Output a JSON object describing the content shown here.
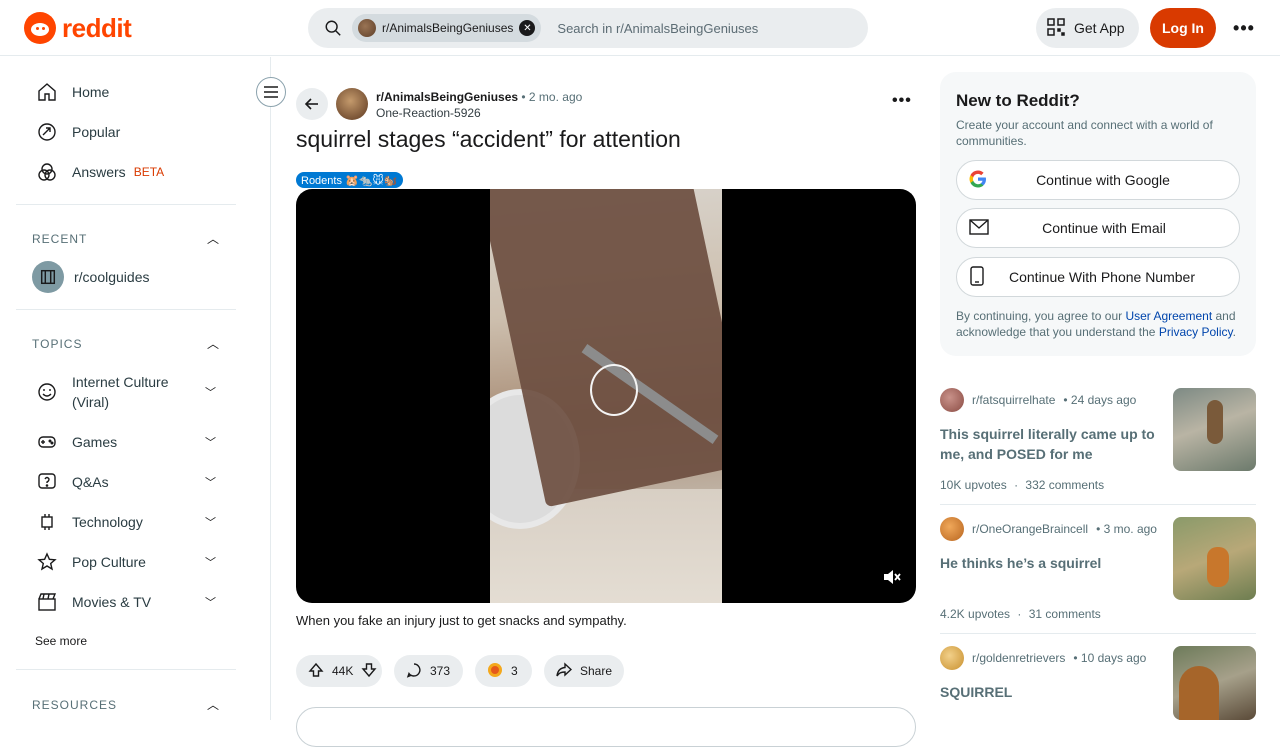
{
  "header": {
    "logo_text": "reddit",
    "search": {
      "chip_label": "r/AnimalsBeingGeniuses",
      "placeholder": "Search in r/AnimalsBeingGeniuses"
    },
    "get_app_label": "Get App",
    "login_label": "Log In",
    "more_label": "•••",
    "accent_color": "#d93a00"
  },
  "sidebar": {
    "nav": [
      {
        "label": "Home",
        "icon": "home-icon"
      },
      {
        "label": "Popular",
        "icon": "popular-icon"
      },
      {
        "label": "Answers",
        "icon": "answers-icon",
        "badge": "BETA"
      }
    ],
    "recent": {
      "title": "RECENT",
      "items": [
        {
          "label": "r/coolguides",
          "icon": "coolguides-icon"
        }
      ]
    },
    "topics": {
      "title": "TOPICS",
      "items": [
        {
          "label": "Internet Culture (Viral)",
          "icon": "smile-icon"
        },
        {
          "label": "Games",
          "icon": "gamepad-icon"
        },
        {
          "label": "Q&As",
          "icon": "question-icon"
        },
        {
          "label": "Technology",
          "icon": "chip-icon"
        },
        {
          "label": "Pop Culture",
          "icon": "star-icon"
        },
        {
          "label": "Movies & TV",
          "icon": "clapper-icon"
        }
      ],
      "see_more": "See more"
    },
    "resources": {
      "title": "RESOURCES"
    }
  },
  "post": {
    "subreddit": "r/AnimalsBeingGeniuses",
    "time": "• 2 mo. ago",
    "author": "One-Reaction-5926",
    "title": "squirrel stages “accident” for attention",
    "flair": "Rodents 🐹🐀🐭🐿️",
    "caption": "When you fake an injury just to get snacks and sympathy.",
    "upvotes": "44K",
    "comments": "373",
    "awards": "3",
    "share_label": "Share",
    "more_label": "•••"
  },
  "signup": {
    "title": "New to Reddit?",
    "subtitle": "Create your account and connect with a world of communities.",
    "google": "Continue with Google",
    "email": "Continue with Email",
    "phone": "Continue With Phone Number",
    "legal_prefix": "By continuing, you agree to our ",
    "legal_link1": "User Agreement",
    "legal_mid": " and acknowledge that you understand the ",
    "legal_link2": "Privacy Policy",
    "legal_suffix": "."
  },
  "related": [
    {
      "subreddit": "r/fatsquirrelhate",
      "time": "• 24 days ago",
      "title": "This squirrel literally came up to me, and POSED for me",
      "upvotes": "10K upvotes",
      "sep": "·",
      "comments": "332 comments"
    },
    {
      "subreddit": "r/OneOrangeBraincell",
      "time": "• 3 mo. ago",
      "title": "He thinks he’s a squirrel",
      "upvotes": "4.2K upvotes",
      "sep": "·",
      "comments": "31 comments"
    },
    {
      "subreddit": "r/goldenretrievers",
      "time": "• 10 days ago",
      "title": "SQUIRREL"
    }
  ]
}
